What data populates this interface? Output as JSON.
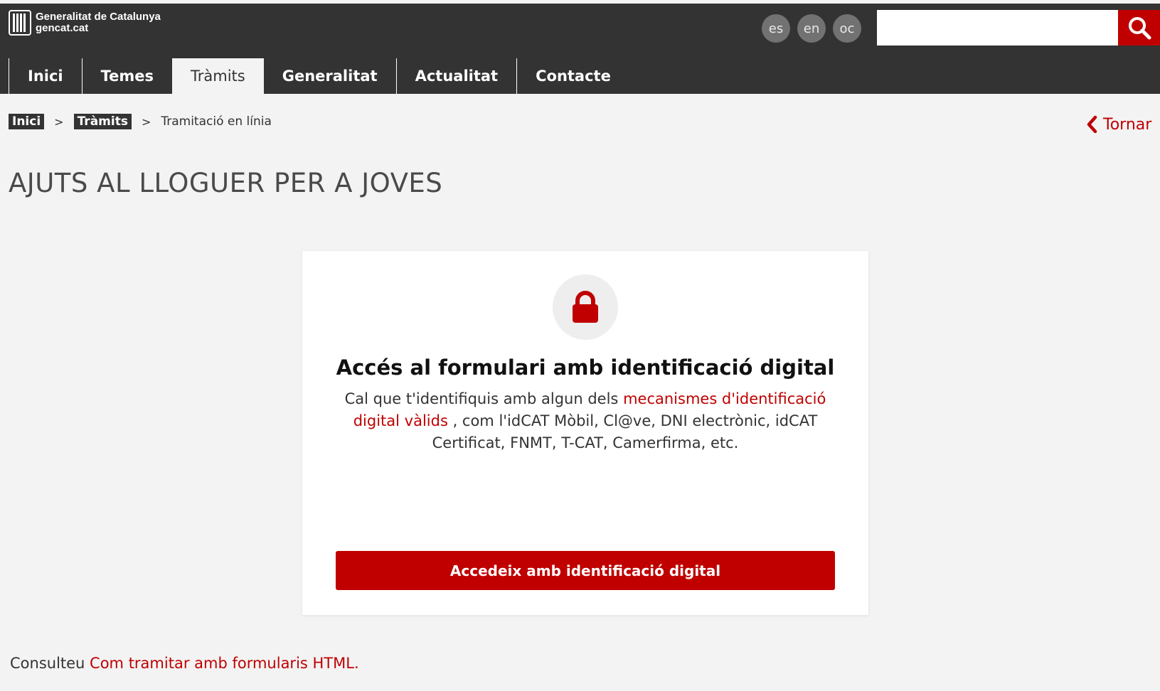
{
  "header": {
    "logo_line1": "Generalitat de Catalunya",
    "logo_line2": "gencat.cat",
    "logo_icon": "generalitat-emblem",
    "languages": [
      "es",
      "en",
      "oc"
    ],
    "search_placeholder": "",
    "search_icon": "magnifier",
    "bar_color": "#333333",
    "accent_color": "#c00000"
  },
  "nav": {
    "items": [
      {
        "label": "Inici"
      },
      {
        "label": "Temes"
      },
      {
        "label": "Tràmits",
        "active": true
      },
      {
        "label": "Generalitat"
      },
      {
        "label": "Actualitat"
      },
      {
        "label": "Contacte"
      }
    ]
  },
  "breadcrumb": {
    "items": [
      "Inici",
      "Tràmits",
      "Tramitació en línia"
    ],
    "separator": ">"
  },
  "back_link": {
    "label": "Tornar",
    "icon": "chevron-left"
  },
  "page": {
    "title": "AJUTS AL LLOGUER PER A JOVES"
  },
  "access_card": {
    "icon": "lock",
    "title": "Accés al formulari amb identificació digital",
    "desc_before": "Cal que t'identifiquis amb algun dels ",
    "desc_link": "mecanismes d'identificació digital vàlids",
    "desc_after": " , com l'idCAT Mòbil, Cl@ve, DNI electrònic, idCAT Certificat, FNMT, T-CAT, Camerfirma, etc.",
    "button_label": "Accedeix amb identificació digital"
  },
  "footer_note": {
    "prefix": "Consulteu ",
    "link": "Com tramitar amb formularis HTML."
  }
}
